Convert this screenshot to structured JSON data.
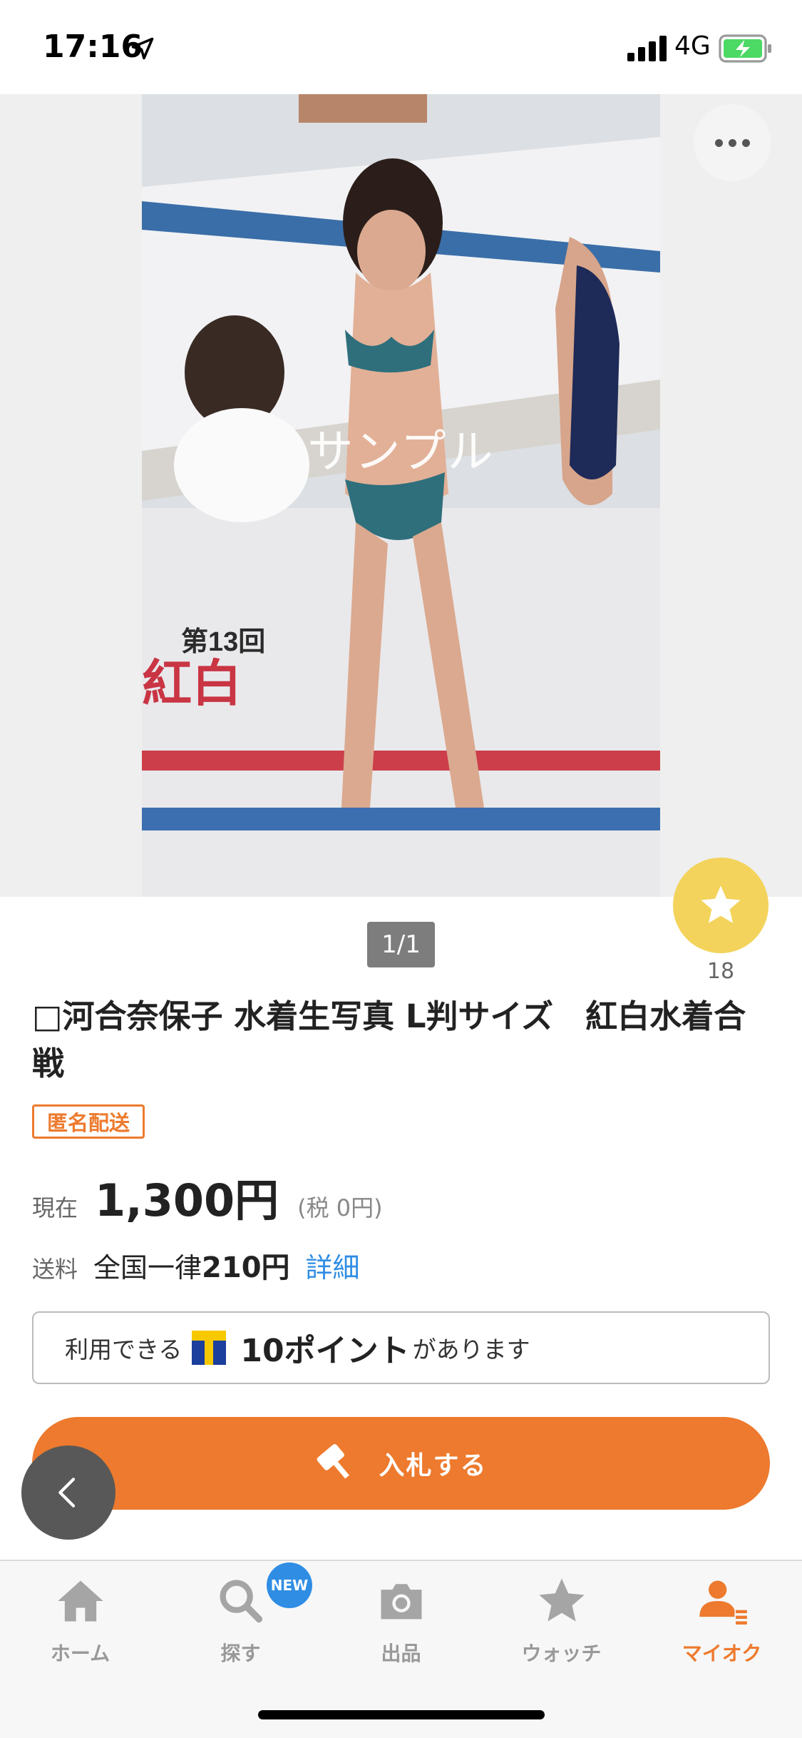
{
  "status": {
    "time": "17:16",
    "network": "4G"
  },
  "hero": {
    "watermark": "サンプル",
    "pager": "1/1"
  },
  "watch": {
    "count": "18"
  },
  "item": {
    "title": "□河合奈保子 水着生写真 L判サイズ　紅白水着合戦",
    "badge": "匿名配送",
    "price_label": "現在",
    "price": "1,300円",
    "tax": "(税 0円)",
    "shipping_label": "送料",
    "shipping_prefix": "全国一律",
    "shipping_amount": "210円",
    "shipping_detail": "詳細"
  },
  "points": {
    "prefix": "利用できる",
    "value": "10ポイント",
    "suffix": "があります"
  },
  "bid": {
    "label": "入札する"
  },
  "tabs": [
    {
      "label": "ホーム",
      "icon": "home-icon"
    },
    {
      "label": "探す",
      "icon": "search-icon",
      "badge": "NEW"
    },
    {
      "label": "出品",
      "icon": "camera-icon"
    },
    {
      "label": "ウォッチ",
      "icon": "star-icon"
    },
    {
      "label": "マイオク",
      "icon": "user-icon"
    }
  ],
  "colors": {
    "accent": "#ed7a2e",
    "link": "#2f8de4",
    "watch": "#f3d35b"
  }
}
